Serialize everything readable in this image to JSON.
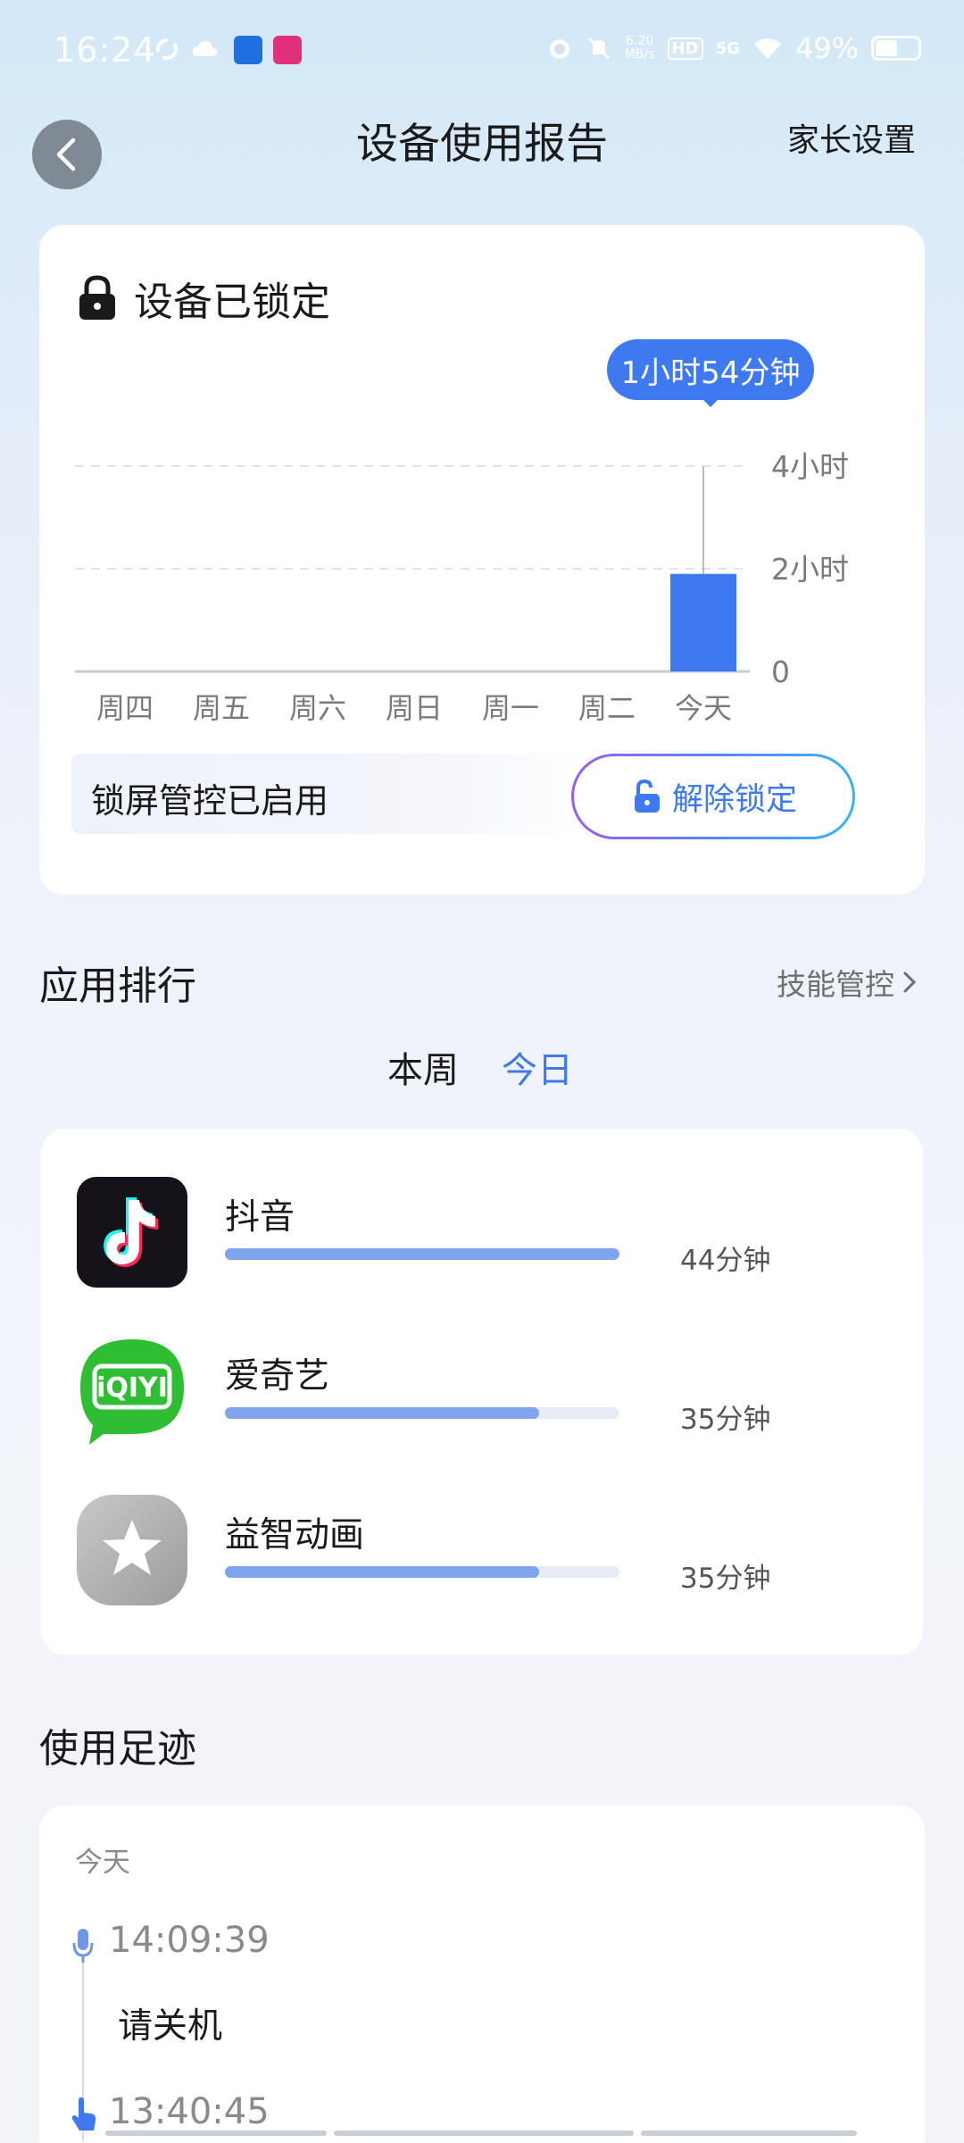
{
  "status_bar": {
    "time": "16:24",
    "speed": "6.20\nMB/s",
    "hd": "HD",
    "network": "5G",
    "battery": "49%"
  },
  "header": {
    "title": "设备使用报告",
    "parent_settings": "家长设置"
  },
  "lock_card": {
    "title": "设备已锁定",
    "tooltip": "1小时54分钟",
    "lock_status": "锁屏管控已启用",
    "unlock_button": "解除锁定"
  },
  "chart_data": {
    "type": "bar",
    "categories": [
      "周四",
      "周五",
      "周六",
      "周日",
      "周一",
      "周二",
      "今天"
    ],
    "values": [
      0,
      0,
      0,
      0,
      0,
      0,
      1.9
    ],
    "y_tick_labels": [
      "0",
      "2小时",
      "4小时"
    ],
    "y_ticks": [
      0,
      2,
      4
    ],
    "ylim": [
      0,
      4
    ],
    "unit": "小时",
    "highlighted_value": "1小时54分钟",
    "bar_color": "#3e79f0",
    "grid": true
  },
  "ranking": {
    "title": "应用排行",
    "skill_link": "技能管控",
    "tab_week": "本周",
    "tab_today": "今日",
    "apps": [
      {
        "name": "抖音",
        "time": "44分钟",
        "minutes": 44,
        "icon": "douyin-icon"
      },
      {
        "name": "爱奇艺",
        "time": "35分钟",
        "minutes": 35,
        "icon": "iqiyi-icon"
      },
      {
        "name": "益智动画",
        "time": "35分钟",
        "minutes": 35,
        "icon": "star-icon"
      }
    ]
  },
  "footprint": {
    "title": "使用足迹",
    "day": "今天",
    "entries": [
      {
        "time": "14:09:39",
        "text": "请关机",
        "icon": "microphone-icon"
      },
      {
        "time": "13:40:45",
        "icon": "hand-pointer-icon"
      }
    ]
  },
  "colors": {
    "accent": "#3e79f0",
    "bar_fill": "#7fa4ec"
  }
}
